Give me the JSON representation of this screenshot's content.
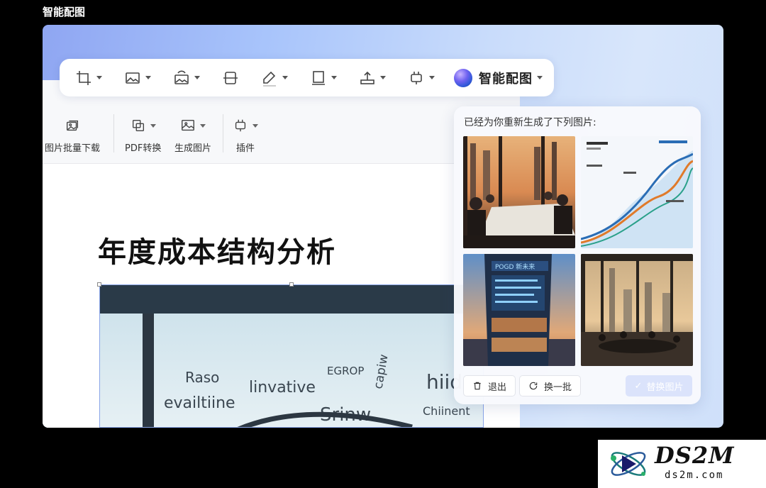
{
  "app_title": "智能配图",
  "toolbar": {
    "items": [
      {
        "icon": "crop-icon"
      },
      {
        "icon": "image-icon"
      },
      {
        "icon": "image-replace-icon"
      },
      {
        "icon": "align-center-icon"
      },
      {
        "icon": "pen-icon"
      },
      {
        "icon": "frame-icon"
      },
      {
        "icon": "upload-icon"
      },
      {
        "icon": "plugin-icon"
      }
    ],
    "ai_label": "智能配图"
  },
  "ribbon": {
    "batch_download": "图片批量下载",
    "pdf_convert": "PDF转换",
    "generate_image": "生成图片",
    "plugins": "插件"
  },
  "document": {
    "title": "年度成本结构分析",
    "image_words": [
      "Raso",
      "linvative",
      "evailtiine",
      "Srinw",
      "hiid",
      "Chiinent",
      "EGROP",
      "capiw"
    ]
  },
  "panel": {
    "title": "已经为你重新生成了下列图片:",
    "thumbnails": [
      {
        "name": "meeting-sunset",
        "desc": "business meeting"
      },
      {
        "name": "infographic-chart",
        "desc": "infographic"
      },
      {
        "name": "tower-building",
        "desc": "building",
        "sign": "POGD 新未来"
      },
      {
        "name": "office-skyline",
        "desc": "office"
      }
    ],
    "exit_label": "退出",
    "refresh_label": "换一批",
    "replace_label": "替换图片"
  },
  "watermark": {
    "brand": "DS2M",
    "url": "ds2m.com"
  },
  "colors": {
    "accent": "#4a6cf0",
    "panel_bg": "#f8f9fd",
    "replace_disabled": "#dbe3fb"
  }
}
